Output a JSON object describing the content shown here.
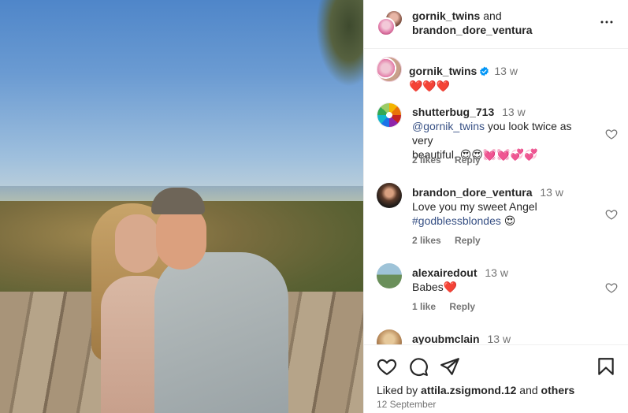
{
  "post": {
    "author_primary": "gornik_twins",
    "joiner": "and",
    "author_secondary": "brandon_dore_ventura"
  },
  "caption": {
    "username": "gornik_twins",
    "time": "13 w",
    "text": "❤️❤️❤️"
  },
  "comments": [
    {
      "username": "shutterbug_713",
      "time": "13 w",
      "mention": "@gornik_twins",
      "text_after_mention": " you look twice as very",
      "text_line2": "beautiful. 😍😍💓💓💞💞",
      "likes": "2 likes",
      "reply": "Reply"
    },
    {
      "username": "brandon_dore_ventura",
      "time": "13 w",
      "text_line1": "Love you my sweet Angel",
      "hashtag": "#godblessblondes",
      "text_after_hashtag": " 😍",
      "likes": "2 likes",
      "reply": "Reply"
    },
    {
      "username": "alexairedout",
      "time": "13 w",
      "text_line1": "Babes❤️",
      "likes": "1 like",
      "reply": "Reply"
    },
    {
      "username": "ayoubmclain",
      "time": "13 w"
    }
  ],
  "actions": {
    "liked_by_prefix": "Liked by ",
    "liked_by_user": "attila.zsigmond.12",
    "liked_by_joiner": " and ",
    "liked_by_others": "others",
    "date": "12 September"
  },
  "icons": {
    "more": "more-horizontal-icon",
    "like": "heart-icon",
    "comment": "comment-icon",
    "share": "share-icon",
    "save": "bookmark-icon",
    "verified": "verified-badge-icon"
  },
  "colors": {
    "link": "#385185",
    "muted": "#737373",
    "text": "#262626",
    "verified": "#0095f6"
  }
}
